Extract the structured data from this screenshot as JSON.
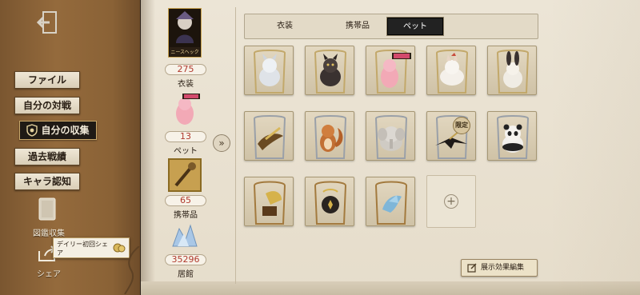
{
  "sidebar": {
    "items": [
      {
        "label": "ファイル"
      },
      {
        "label": "自分の対戦"
      },
      {
        "label": "自分の収集"
      },
      {
        "label": "過去戦績"
      },
      {
        "label": "キャラ認知"
      }
    ],
    "book_label": "図鑑収集",
    "share_label": "シェア",
    "tooltip": "デイリー初回シェア"
  },
  "stats": [
    {
      "value": "275",
      "label": "衣装",
      "card_text": "ニースヘック"
    },
    {
      "value": "13",
      "label": "ペット"
    },
    {
      "value": "65",
      "label": "携帯品"
    },
    {
      "value": "35296",
      "label": "居館"
    }
  ],
  "tabs": [
    {
      "label": "衣装"
    },
    {
      "label": "携帯品"
    },
    {
      "label": "ペット",
      "active": true
    }
  ],
  "pets": {
    "limited_badge": "限定",
    "items": [
      {
        "icon": "white-wolf-pet-icon"
      },
      {
        "icon": "black-wolf-pet-icon"
      },
      {
        "icon": "pink-creature-pet-icon"
      },
      {
        "icon": "white-fox-pet-icon"
      },
      {
        "icon": "rabbit-pet-icon"
      },
      {
        "icon": "bird-pet-icon"
      },
      {
        "icon": "squirrel-pet-icon"
      },
      {
        "icon": "elephant-pet-icon"
      },
      {
        "icon": "crow-pet-icon",
        "limited": true
      },
      {
        "icon": "panda-pet-icon"
      },
      {
        "icon": "gramophone-pet-icon"
      },
      {
        "icon": "black-bird-pet-icon"
      },
      {
        "icon": "blue-bird-pet-icon"
      }
    ]
  },
  "effect_button": "展示効果編集",
  "colors": {
    "accent_red": "#b03a2e",
    "active_tab": "#222222",
    "gold": "#caa96b"
  }
}
